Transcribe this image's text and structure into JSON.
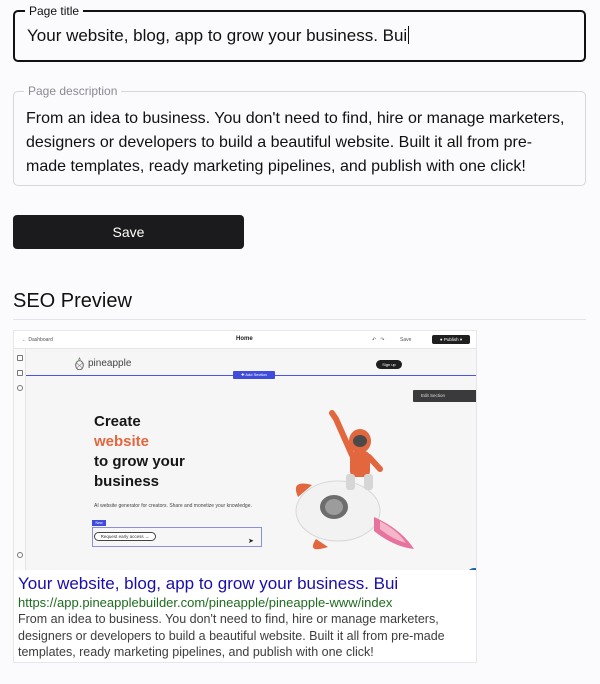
{
  "title_field": {
    "label": "Page title",
    "value": "Your website, blog, app to grow your business. Bui"
  },
  "description_field": {
    "label": "Page description",
    "value": "From an idea to business. You don't need to find, hire or manage marketers, designers or developers to build a beautiful website. Built it all from pre-made templates, ready marketing pipelines, and publish with one click!"
  },
  "save_button": {
    "label": "Save"
  },
  "seo": {
    "heading": "SEO Preview",
    "screenshot": {
      "back_link": "← Dashboard",
      "page_name": "Home",
      "save_label": "Save",
      "publish_label": "● Publish ▾",
      "edit_section_tag": "✚ Add Section",
      "logo_text": "pineapple",
      "signup_label": "Sign up",
      "editbar_label": "Edit Section",
      "hero_line1": "Create",
      "hero_accent": "website",
      "hero_line3": "to grow your",
      "hero_line4": "business",
      "hero_sub": "AI website generator for creators. Share and monetize your knowledge.",
      "new_tag": "New",
      "request_button": "Request early access →"
    },
    "result_title": "Your website, blog, app to grow your business. Bui",
    "result_url": "https://app.pineapplebuilder.com/pineapple/pineapple-www/index",
    "result_description": "From an idea to business. You don't need to find, hire or manage marketers, designers or developers to build a beautiful website. Built it all from pre-made templates, ready marketing pipelines, and publish with one click!"
  },
  "colors": {
    "accent_orange": "#e2673f",
    "result_title_blue": "#1a0dab",
    "result_url_green": "#1e6b1e",
    "editor_blue": "#3f4bdb"
  }
}
